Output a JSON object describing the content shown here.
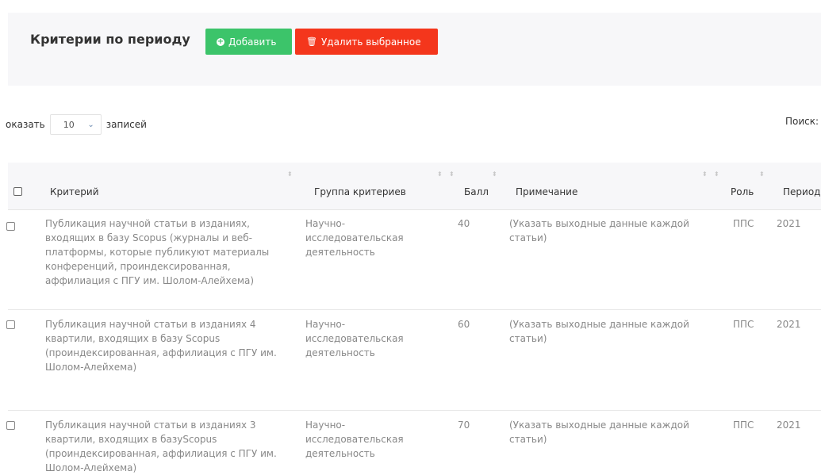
{
  "header": {
    "title": "Критерии по периоду",
    "add_label": "Добавить",
    "delete_label": "Удалить выбранное"
  },
  "controls": {
    "length_prefix": "оказать",
    "length_value": "10",
    "length_suffix": "записей",
    "search_label": "Поиск:"
  },
  "table": {
    "columns": [
      "Критерий",
      "Группа критериев",
      "Балл",
      "Примечание",
      "Роль",
      "Период"
    ],
    "rows": [
      {
        "criterion": "Публикация научной статьи в изданиях, входящих в базу Scopus (журналы и веб-платформы, которые публикуют материалы конференций, проиндексированная, аффилиация с ПГУ им. Шолом-Алейхема)",
        "group": "Научно-исследовательская деятельность",
        "score": "40",
        "note": "(Указать выходные данные каждой статьи)",
        "role": "ППС",
        "period": "2021"
      },
      {
        "criterion": "Публикация научной статьи в изданиях 4 квартили, входящих в базу Scopus (проиндексированная, аффилиация с ПГУ им. Шолом-Алейхема)",
        "group": "Научно-исследовательская деятельность",
        "score": "60",
        "note": "(Указать выходные данные каждой статьи)",
        "role": "ППС",
        "period": "2021"
      },
      {
        "criterion": "Публикация научной статьи в изданиях 3 квартили, входящих в базуScopus (проиндексированная, аффилиация с ПГУ им. Шолом-Алейхема)",
        "group": "Научно-исследовательская деятельность",
        "score": "70",
        "note": "(Указать выходные данные каждой статьи)",
        "role": "ППС",
        "period": "2021"
      }
    ]
  }
}
